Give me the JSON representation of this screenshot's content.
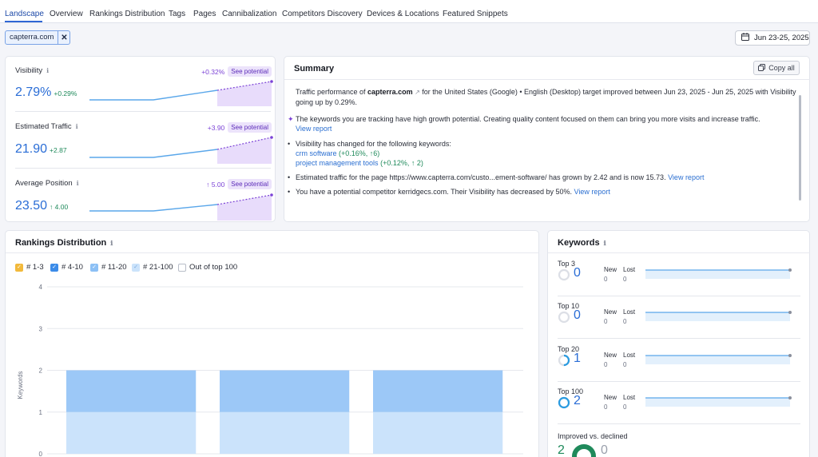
{
  "tabs": [
    {
      "label": "Landscape",
      "active": true
    },
    {
      "label": "Overview"
    },
    {
      "label": "Rankings Distribution"
    },
    {
      "label": "Tags"
    },
    {
      "label": "Pages"
    },
    {
      "label": "Cannibalization"
    },
    {
      "label": "Competitors Discovery"
    },
    {
      "label": "Devices & Locations"
    },
    {
      "label": "Featured Snippets"
    }
  ],
  "filter_chip": "capterra.com",
  "date_range": "Jun 23-25, 2025",
  "metrics": [
    {
      "title": "Visibility",
      "value": "2.79%",
      "delta": "+0.29%",
      "potential_delta": "+0.32%",
      "potential_btn": "See potential"
    },
    {
      "title": "Estimated Traffic",
      "value": "21.90",
      "delta": "+2.87",
      "potential_delta": "+3.90",
      "potential_btn": "See potential"
    },
    {
      "title": "Average Position",
      "value": "23.50",
      "delta": "↑ 4.00",
      "potential_delta": "↑ 5.00",
      "potential_btn": "See potential"
    }
  ],
  "summary": {
    "title": "Summary",
    "copy_label": "Copy all",
    "intro_before": "Traffic performance of ",
    "intro_domain": "capterra.com",
    "intro_after": " for the United States (Google) • English (Desktop) target improved between Jun 23, 2025 - Jun 25, 2025 with Visibility going up by 0.29%.",
    "ai_text": "The keywords you are tracking have high growth potential. Creating quality content focused on them can bring you more visits and increase traffic.",
    "view_report": "View report",
    "visibility_changed": "Visibility has changed for the following keywords:",
    "kw1": "crm software",
    "kw1_delta": "(+0.16%, ↑6)",
    "kw2": "project management tools",
    "kw2_delta": "(+0.12%, ↑ 2)",
    "traffic_text": "Estimated traffic for the page https://www.capterra.com/custo...ement-software/ has grown by 2.42 and is now 15.73.",
    "competitor_text": "You have a potential competitor kerridgecs.com. Their Visibility has decreased by 50%."
  },
  "rankings": {
    "title": "Rankings Distribution",
    "legend": [
      {
        "label": "# 1-3",
        "color": "#f2b93b",
        "checked": true
      },
      {
        "label": "# 4-10",
        "color": "#3b8be8",
        "checked": true
      },
      {
        "label": "# 11-20",
        "color": "#8cc0f5",
        "checked": true
      },
      {
        "label": "# 21-100",
        "color": "#cbe3fb",
        "checked": true
      },
      {
        "label": "Out of top 100",
        "color": "#ffffff",
        "checked": false
      }
    ],
    "y_axis_label": "Keywords"
  },
  "chart_data": {
    "type": "bar",
    "stacked": true,
    "categories": [
      "",
      "",
      ""
    ],
    "series": [
      {
        "name": "# 21-100",
        "color": "#cbe3fb",
        "values": [
          1,
          1,
          1
        ]
      },
      {
        "name": "# 11-20",
        "color": "#9cc8f7",
        "values": [
          1,
          1,
          1
        ]
      }
    ],
    "y_ticks": [
      "4",
      "3",
      "2",
      "1",
      "0"
    ],
    "ylabel": "Keywords",
    "ylim": [
      0,
      4
    ],
    "grid": true
  },
  "keywords": {
    "title": "Keywords",
    "rows": [
      {
        "label": "Top 3",
        "value": "0",
        "new_label": "New",
        "lost_label": "Lost",
        "new": "0",
        "lost": "0",
        "ring_fill": 0
      },
      {
        "label": "Top 10",
        "value": "0",
        "new_label": "New",
        "lost_label": "Lost",
        "new": "0",
        "lost": "0",
        "ring_fill": 0
      },
      {
        "label": "Top 20",
        "value": "1",
        "new_label": "New",
        "lost_label": "Lost",
        "new": "0",
        "lost": "0",
        "ring_fill": 0.5
      },
      {
        "label": "Top 100",
        "value": "2",
        "new_label": "New",
        "lost_label": "Lost",
        "new": "0",
        "lost": "0",
        "ring_fill": 1
      }
    ],
    "improved_label": "Improved vs. declined",
    "improved": "2",
    "declined": "0"
  }
}
